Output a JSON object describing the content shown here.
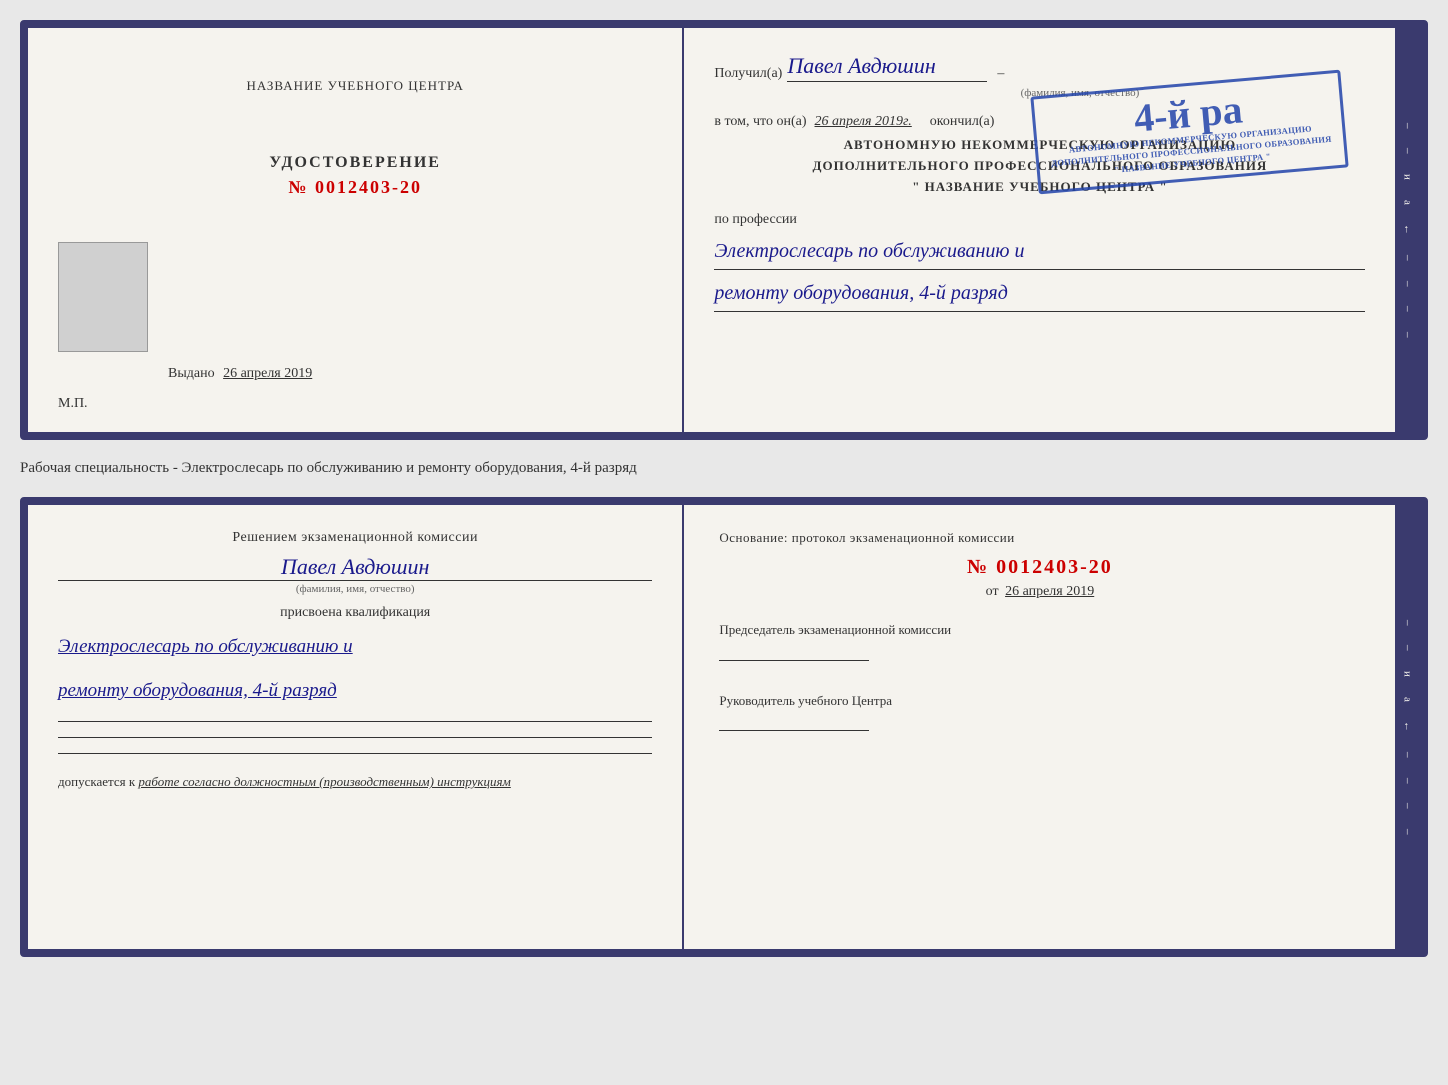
{
  "topDoc": {
    "left": {
      "centerTitle": "НАЗВАНИЕ УЧЕБНОГО ЦЕНТРА",
      "udostoverenie": "УДОСТОВЕРЕНИЕ",
      "number": "№ 0012403-20",
      "vydanoLabel": "Выдано",
      "vydanoDate": "26 апреля 2019",
      "mpLabel": "М.П."
    },
    "right": {
      "poluchilLabel": "Получил(a)",
      "recipientName": "Павел Авдюшин",
      "fioSubtitle": "(фамилия, имя, отчество)",
      "vtomLabel": "в том, что он(a)",
      "vtomDate": "26 апреля 2019г.",
      "okochilLabel": "окончил(а)",
      "avtTitle1": "АВТОНОМНУЮ НЕКОММЕРЧЕСКУЮ ОРГАНИЗАЦИЮ",
      "avtTitle2": "ДОПОЛНИТЕЛЬНОГО ПРОФЕССИОНАЛЬНОГО ОБРАЗОВАНИЯ",
      "avtTitle3": "\" НАЗВАНИЕ УЧЕБНОГО ЦЕНТРА \"",
      "poLrofessiiLabel": "по профессии",
      "profession1": "Электрослесарь по обслуживанию и",
      "profession2": "ремонту оборудования, 4-й разряд",
      "stampLines": [
        "4-й ра",
        "АВТОНОМНУЮ НЕКОММЕРЧЕСКУЮ ОРГАНИЗАЦИЮ",
        "ДОПОЛНИТЕЛЬНОГО ПРОФЕССИОНАЛЬНОГО ОБРАЗОВАНИЯ",
        "\" НАЗВАНИЕ УЧЕБНОГО ЦЕНТРА \""
      ]
    },
    "sideBar": [
      "–",
      "–",
      "–",
      "и",
      "а",
      "←",
      "–",
      "–",
      "–",
      "–"
    ]
  },
  "separatorText": "Рабочая специальность - Электрослесарь по обслуживанию и ремонту оборудования, 4-й разряд",
  "bottomDoc": {
    "left": {
      "resheniemText": "Решением экзаменационной комиссии",
      "personName": "Павел Авдюшин",
      "fioSubtitle": "(фамилия, имя, отчество)",
      "prisvoenaText": "присвоена квалификация",
      "profession1": "Электрослесарь по обслуживанию и",
      "profession2": "ремонту оборудования, 4-й разряд",
      "dopuskaetsyaLabel": "допускается к",
      "dopuskaetsyaText": "работе согласно должностным (производственным) инструкциям"
    },
    "right": {
      "osnovanieLAbel": "Основание: протокол экзаменационной комиссии",
      "numberLabel": "№ 0012403-20",
      "otLabel": "от",
      "otDate": "26 апреля 2019",
      "predsedatelLabel": "Председатель экзаменационной комиссии",
      "rukovoditelLabel": "Руководитель учебного Центра"
    },
    "sideBar": [
      "–",
      "–",
      "–",
      "и",
      "а",
      "←",
      "–",
      "–",
      "–",
      "–"
    ]
  }
}
